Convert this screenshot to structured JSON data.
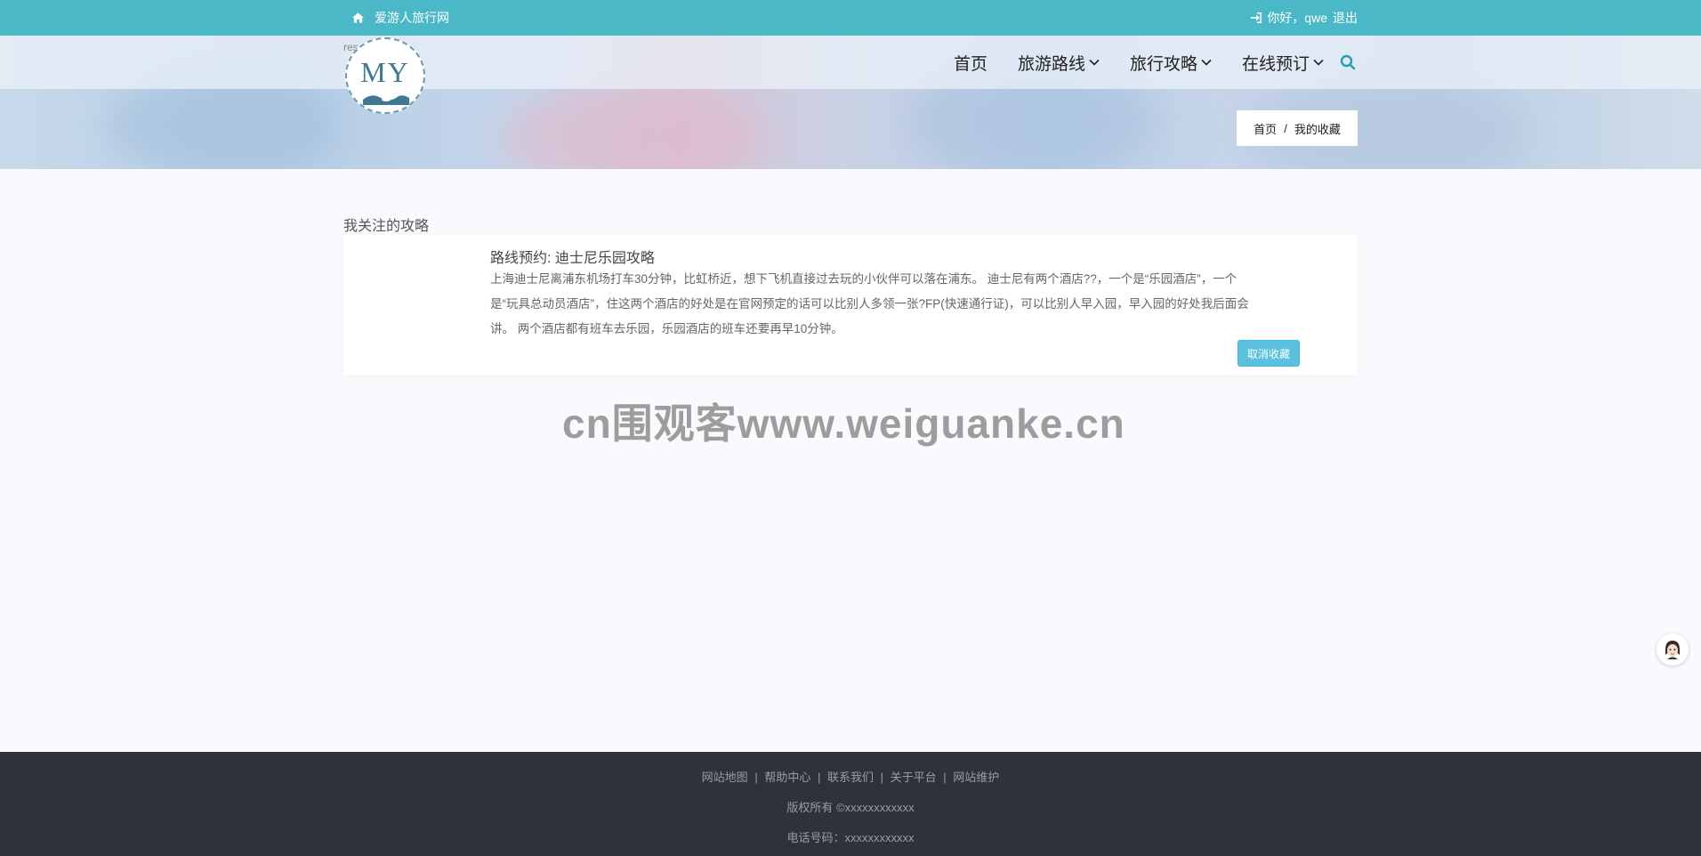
{
  "topbar": {
    "site_name": "爱游人旅行网",
    "greeting": "你好，qwe",
    "logout": "退出"
  },
  "logo": {
    "alt_text": "res",
    "letters": "MY"
  },
  "nav": {
    "items": [
      {
        "label": "首页"
      },
      {
        "label": "旅游路线"
      },
      {
        "label": "旅行攻略"
      },
      {
        "label": "在线预订"
      }
    ]
  },
  "breadcrumb": {
    "home": "首页",
    "separator": "/",
    "current": "我的收藏"
  },
  "section": {
    "title": "我关注的攻略"
  },
  "favorites": [
    {
      "title": "路线预约: 迪士尼乐园攻略",
      "lines": [
        "上海迪士尼离浦东机场打车30分钟，比虹桥近，想下飞机直接过去玩的小伙伴可以落在浦东。        迪士尼有两个酒店??，一个是“乐园酒店”，一个",
        "是“玩具总动员酒店”，住这两个酒店的好处是在官网预定的话可以比别人多领一张?FP(快速通行证)，可以比别人早入园，早入园的好处我后面会",
        "讲。        两个酒店都有班车去乐园，乐园酒店的班车还要再早10分钟。"
      ],
      "button": "取消收藏"
    }
  ],
  "watermark": "cn围观客www.weiguanke.cn",
  "footer": {
    "links": [
      "网站地图",
      "帮助中心",
      "联系我们",
      "关于平台",
      "网站维护"
    ],
    "separator": "|",
    "copyright": "版权所有 ©xxxxxxxxxxxx",
    "phone": "电话号码：xxxxxxxxxxxx"
  },
  "colors": {
    "topbar": "#4ab8c6",
    "button": "#5bc0de",
    "footer": "#2f313b"
  }
}
